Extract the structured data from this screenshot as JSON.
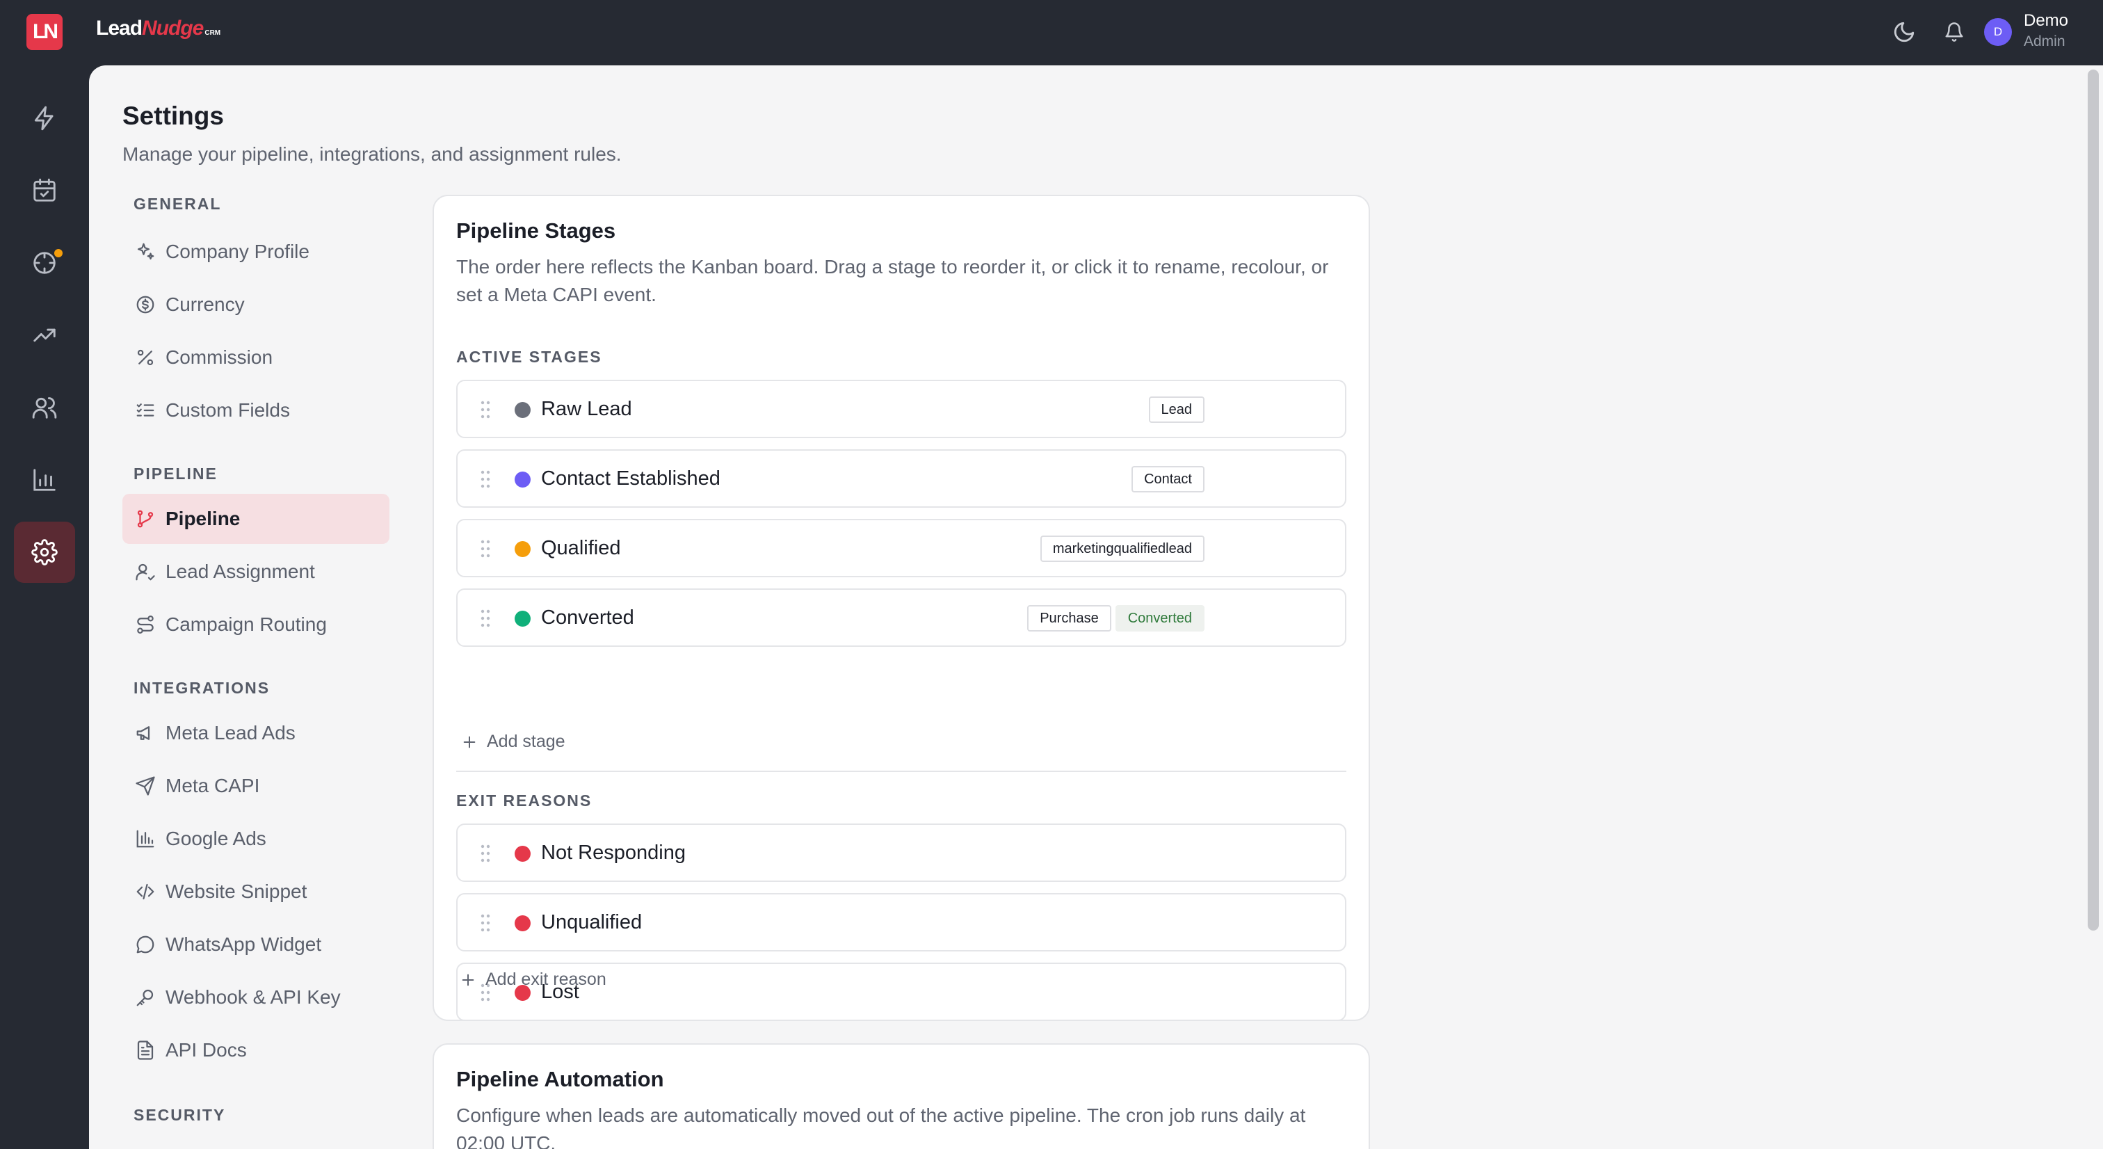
{
  "app": {
    "logo_mark": "LN",
    "logo_lead": "Lead",
    "logo_nudge": "Nudge",
    "logo_crm": "CRM"
  },
  "topbar": {
    "icons": [
      "moon-icon",
      "bell-icon"
    ],
    "user": {
      "initial": "D",
      "name": "Demo",
      "role": "Admin"
    }
  },
  "rail": {
    "items": [
      "lightning-icon",
      "calendar-check-icon",
      "target-icon",
      "trending-up-icon",
      "users-icon",
      "bar-chart-icon",
      "gear-icon"
    ],
    "active": "gear-icon",
    "notification_dot_color": "#f59e0b"
  },
  "page": {
    "title": "Settings",
    "subtitle": "Manage your pipeline, integrations, and assignment rules."
  },
  "settings_nav": {
    "general_heading": "GENERAL",
    "general": [
      "Company Profile",
      "Currency",
      "Commission",
      "Custom Fields"
    ],
    "pipeline_heading": "PIPELINE",
    "pipeline": [
      "Pipeline",
      "Lead Assignment",
      "Campaign Routing"
    ],
    "integrations_heading": "INTEGRATIONS",
    "integrations": [
      "Meta Lead Ads",
      "Meta CAPI",
      "Google Ads",
      "Website Snippet",
      "WhatsApp Widget",
      "Webhook & API Key",
      "API Docs"
    ],
    "security_heading": "SECURITY",
    "active_item": "Pipeline"
  },
  "pipeline_card": {
    "title": "Pipeline Stages",
    "description": "The order here reflects the Kanban board. Drag a stage to reorder it, or click it to rename, recolour, or set a Meta CAPI event.",
    "active_heading": "ACTIVE STAGES",
    "active_stages": [
      {
        "name": "Raw Lead",
        "color": "#6b6f7a",
        "event": "Lead"
      },
      {
        "name": "Contact Established",
        "color": "#6d5df5",
        "event": "Contact"
      },
      {
        "name": "Qualified",
        "color": "#f59e0b",
        "event": "marketingqualifiedlead"
      },
      {
        "name": "Converted",
        "color": "#10b07a",
        "event": "Purchase",
        "status": "Converted"
      }
    ],
    "add_stage": "Add stage",
    "exit_heading": "EXIT REASONS",
    "exit_reasons": [
      {
        "name": "Not Responding",
        "color": "#e5384a"
      },
      {
        "name": "Unqualified",
        "color": "#e5384a"
      },
      {
        "name": "Lost",
        "color": "#e5384a"
      }
    ],
    "add_exit": "Add exit reason"
  },
  "automation_card": {
    "title": "Pipeline Automation",
    "description": "Configure when leads are automatically moved out of the active pipeline. The cron job runs daily at 02:00 UTC."
  }
}
